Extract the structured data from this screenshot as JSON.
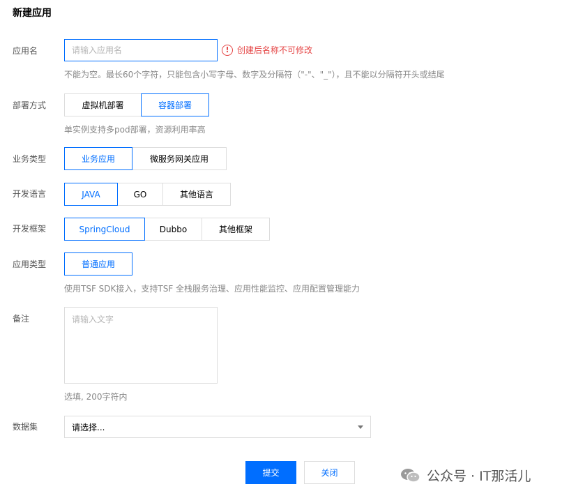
{
  "page": {
    "title": "新建应用"
  },
  "app_name": {
    "label": "应用名",
    "placeholder": "请输入应用名",
    "error": "创建后名称不可修改",
    "hint": "不能为空。最长60个字符，只能包含小写字母、数字及分隔符（\"-\"、\"_\"），且不能以分隔符开头或结尾"
  },
  "deploy": {
    "label": "部署方式",
    "options": [
      "虚拟机部署",
      "容器部署"
    ],
    "selected": "容器部署",
    "hint": "单实例支持多pod部署，资源利用率高"
  },
  "business_type": {
    "label": "业务类型",
    "options": [
      "业务应用",
      "微服务网关应用"
    ],
    "selected": "业务应用"
  },
  "language": {
    "label": "开发语言",
    "options": [
      "JAVA",
      "GO",
      "其他语言"
    ],
    "selected": "JAVA"
  },
  "framework": {
    "label": "开发框架",
    "options": [
      "SpringCloud",
      "Dubbo",
      "其他框架"
    ],
    "selected": "SpringCloud"
  },
  "app_type": {
    "label": "应用类型",
    "options": [
      "普通应用"
    ],
    "selected": "普通应用",
    "hint": "使用TSF SDK接入，支持TSF 全栈服务治理、应用性能监控、应用配置管理能力"
  },
  "remark": {
    "label": "备注",
    "placeholder": "请输入文字",
    "hint": "选填, 200字符内"
  },
  "dataset": {
    "label": "数据集",
    "value": "请选择..."
  },
  "actions": {
    "submit": "提交",
    "close": "关闭"
  },
  "watermark": {
    "text": "公众号 · IT那活儿"
  },
  "colors": {
    "primary": "#006eff",
    "error": "#e54545",
    "border": "#dddddd"
  }
}
